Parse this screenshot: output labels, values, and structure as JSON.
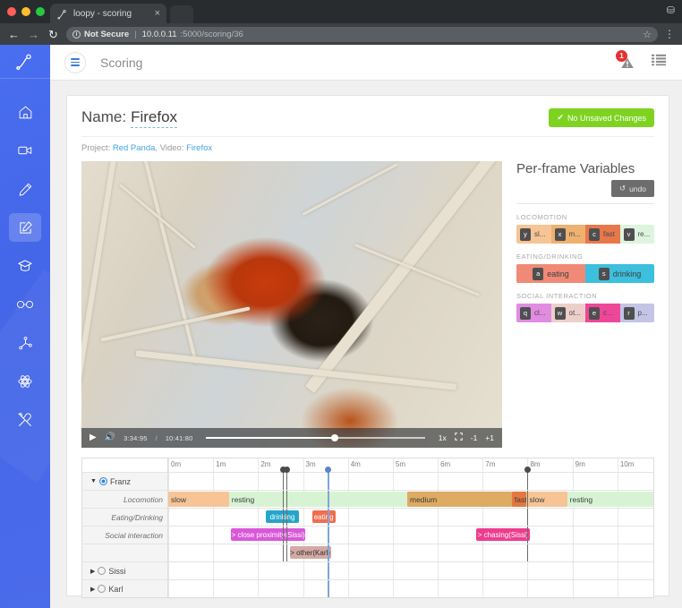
{
  "browser": {
    "tab_title": "loopy - scoring",
    "tab_favicon": "loopy-logo-icon",
    "close_label": "×",
    "back_icon": "←",
    "forward_icon": "→",
    "reload_icon": "↻",
    "security_icon": "info-icon",
    "security_text": "Not Secure",
    "url_separator": "|",
    "url_host": "10.0.0.11",
    "url_path": ":5000/scoring/36",
    "star_icon": "☆",
    "menu_icon": "⋮",
    "profile_icon": "⛁"
  },
  "rail": {
    "logo_name": "loopy-logo-icon",
    "items": [
      {
        "name": "home-icon",
        "label": "Home"
      },
      {
        "name": "video-camera-icon",
        "label": "Videos"
      },
      {
        "name": "pencil-icon",
        "label": "Edit"
      },
      {
        "name": "scoring-icon",
        "label": "Scoring",
        "active": true
      },
      {
        "name": "graduation-cap-icon",
        "label": "Training"
      },
      {
        "name": "binoculars-icon",
        "label": "Observe"
      },
      {
        "name": "network-icon",
        "label": "Network"
      },
      {
        "name": "atom-icon",
        "label": "Models"
      },
      {
        "name": "tools-icon",
        "label": "Tools"
      }
    ]
  },
  "topbar": {
    "menu_icon": "hamburger-icon",
    "title": "Scoring",
    "notification_icon": "alert-upload-icon",
    "notification_count": "1",
    "list_icon": "list-icon"
  },
  "card": {
    "name_label": "Name:",
    "name_value": "Firefox",
    "save_badge": "No Unsaved Changes",
    "save_badge_icon": "✔",
    "save_badge_color": "#7ed321",
    "breadcrumb_project_label": "Project:",
    "breadcrumb_project": "Red Panda",
    "breadcrumb_comma": ",",
    "breadcrumb_video_label": "Video:",
    "breadcrumb_video": "Firefox",
    "link_color": "#46a5e0"
  },
  "video": {
    "play_icon": "▶",
    "volume_icon": "🔊",
    "current_time": "3:34:95",
    "separator": "/",
    "total_time": "10:41:80",
    "progress_percent": 57,
    "speed_label": "1x",
    "fullscreen_icon": "fullscreen-icon",
    "step_back_label": "-1",
    "step_forward_label": "+1"
  },
  "pfv": {
    "title": "Per-frame Variables",
    "undo_label": "undo",
    "undo_icon": "↺",
    "groups": [
      {
        "name": "LOCOMOTION",
        "buttons": [
          {
            "key": "y",
            "label": "sl...",
            "full": "slow",
            "color": "#f7c496"
          },
          {
            "key": "x",
            "label": "m...",
            "full": "medium",
            "color": "#eeb170"
          },
          {
            "key": "c",
            "label": "fast",
            "full": "fast",
            "color": "#e8784b"
          },
          {
            "key": "v",
            "label": "re...",
            "full": "resting",
            "color": "#ddf5dd"
          }
        ]
      },
      {
        "name": "EATING/DRINKING",
        "buttons": [
          {
            "key": "a",
            "label": "eating",
            "full": "eating",
            "color": "#f08a76"
          },
          {
            "key": "s",
            "label": "drinking",
            "full": "drinking",
            "color": "#3cc0dd"
          }
        ]
      },
      {
        "name": "SOCIAL INTERACTION",
        "buttons": [
          {
            "key": "q",
            "label": "cl...",
            "full": "close proximity",
            "color": "#e08ce0"
          },
          {
            "key": "w",
            "label": "ot...",
            "full": "other",
            "color": "#eccfcb"
          },
          {
            "key": "e",
            "label": "ch...",
            "full": "chasing",
            "color": "#ee4799"
          },
          {
            "key": "r",
            "label": "p...",
            "full": "proximity",
            "color": "#c3c4e6"
          }
        ]
      }
    ]
  },
  "timeline": {
    "ticks": [
      "0m",
      "1m",
      "2m",
      "3m",
      "4m",
      "5m",
      "6m",
      "7m",
      "8m",
      "9m",
      "10m"
    ],
    "axis_max_minutes": 10.8,
    "playhead_minutes": 3.55,
    "markers": [
      2.55,
      2.63,
      8.0
    ],
    "subjects": [
      {
        "name": "Franz",
        "expanded": true,
        "selected": true,
        "caret": "▼",
        "tracks": [
          {
            "label": "Locomotion",
            "segments": [
              {
                "label": "slow",
                "start": 0.0,
                "end": 1.35,
                "color": "#f7c496"
              },
              {
                "label": "resting",
                "start": 1.35,
                "end": 5.32,
                "color": "#d8f3d4"
              },
              {
                "label": "medium",
                "start": 5.32,
                "end": 7.65,
                "color": "#ddab62"
              },
              {
                "label": "fast",
                "start": 7.65,
                "end": 7.98,
                "color": "#e4783f"
              },
              {
                "label": "slow",
                "start": 7.98,
                "end": 8.88,
                "color": "#f7c496"
              },
              {
                "label": "resting",
                "start": 8.88,
                "end": 10.8,
                "color": "#d8f3d4"
              }
            ]
          },
          {
            "label": "Eating/Drinking",
            "events": [
              {
                "label": "drinking",
                "start": 2.18,
                "end": 2.9,
                "color": "#24a5c9",
                "white": true
              },
              {
                "label": "eating",
                "start": 3.2,
                "end": 3.72,
                "color": "#ef6e4e",
                "white": true
              }
            ]
          },
          {
            "label": "Social interaction",
            "events": [
              {
                "label": "> close proximity(Sissi)",
                "start": 1.4,
                "end": 3.05,
                "color": "#d957d9",
                "white": true
              },
              {
                "label": "> chasing(Sissi)",
                "start": 6.85,
                "end": 8.06,
                "color": "#ee3d8e",
                "white": true
              }
            ],
            "events_row2": [
              {
                "label": "> other(Karl)",
                "start": 2.7,
                "end": 3.62,
                "color": "#d4a9a4",
                "white": false
              }
            ]
          }
        ]
      },
      {
        "name": "Sissi",
        "expanded": false,
        "selected": false,
        "caret": "▶",
        "tracks": []
      },
      {
        "name": "Karl",
        "expanded": false,
        "selected": false,
        "caret": "▶",
        "tracks": []
      }
    ]
  }
}
